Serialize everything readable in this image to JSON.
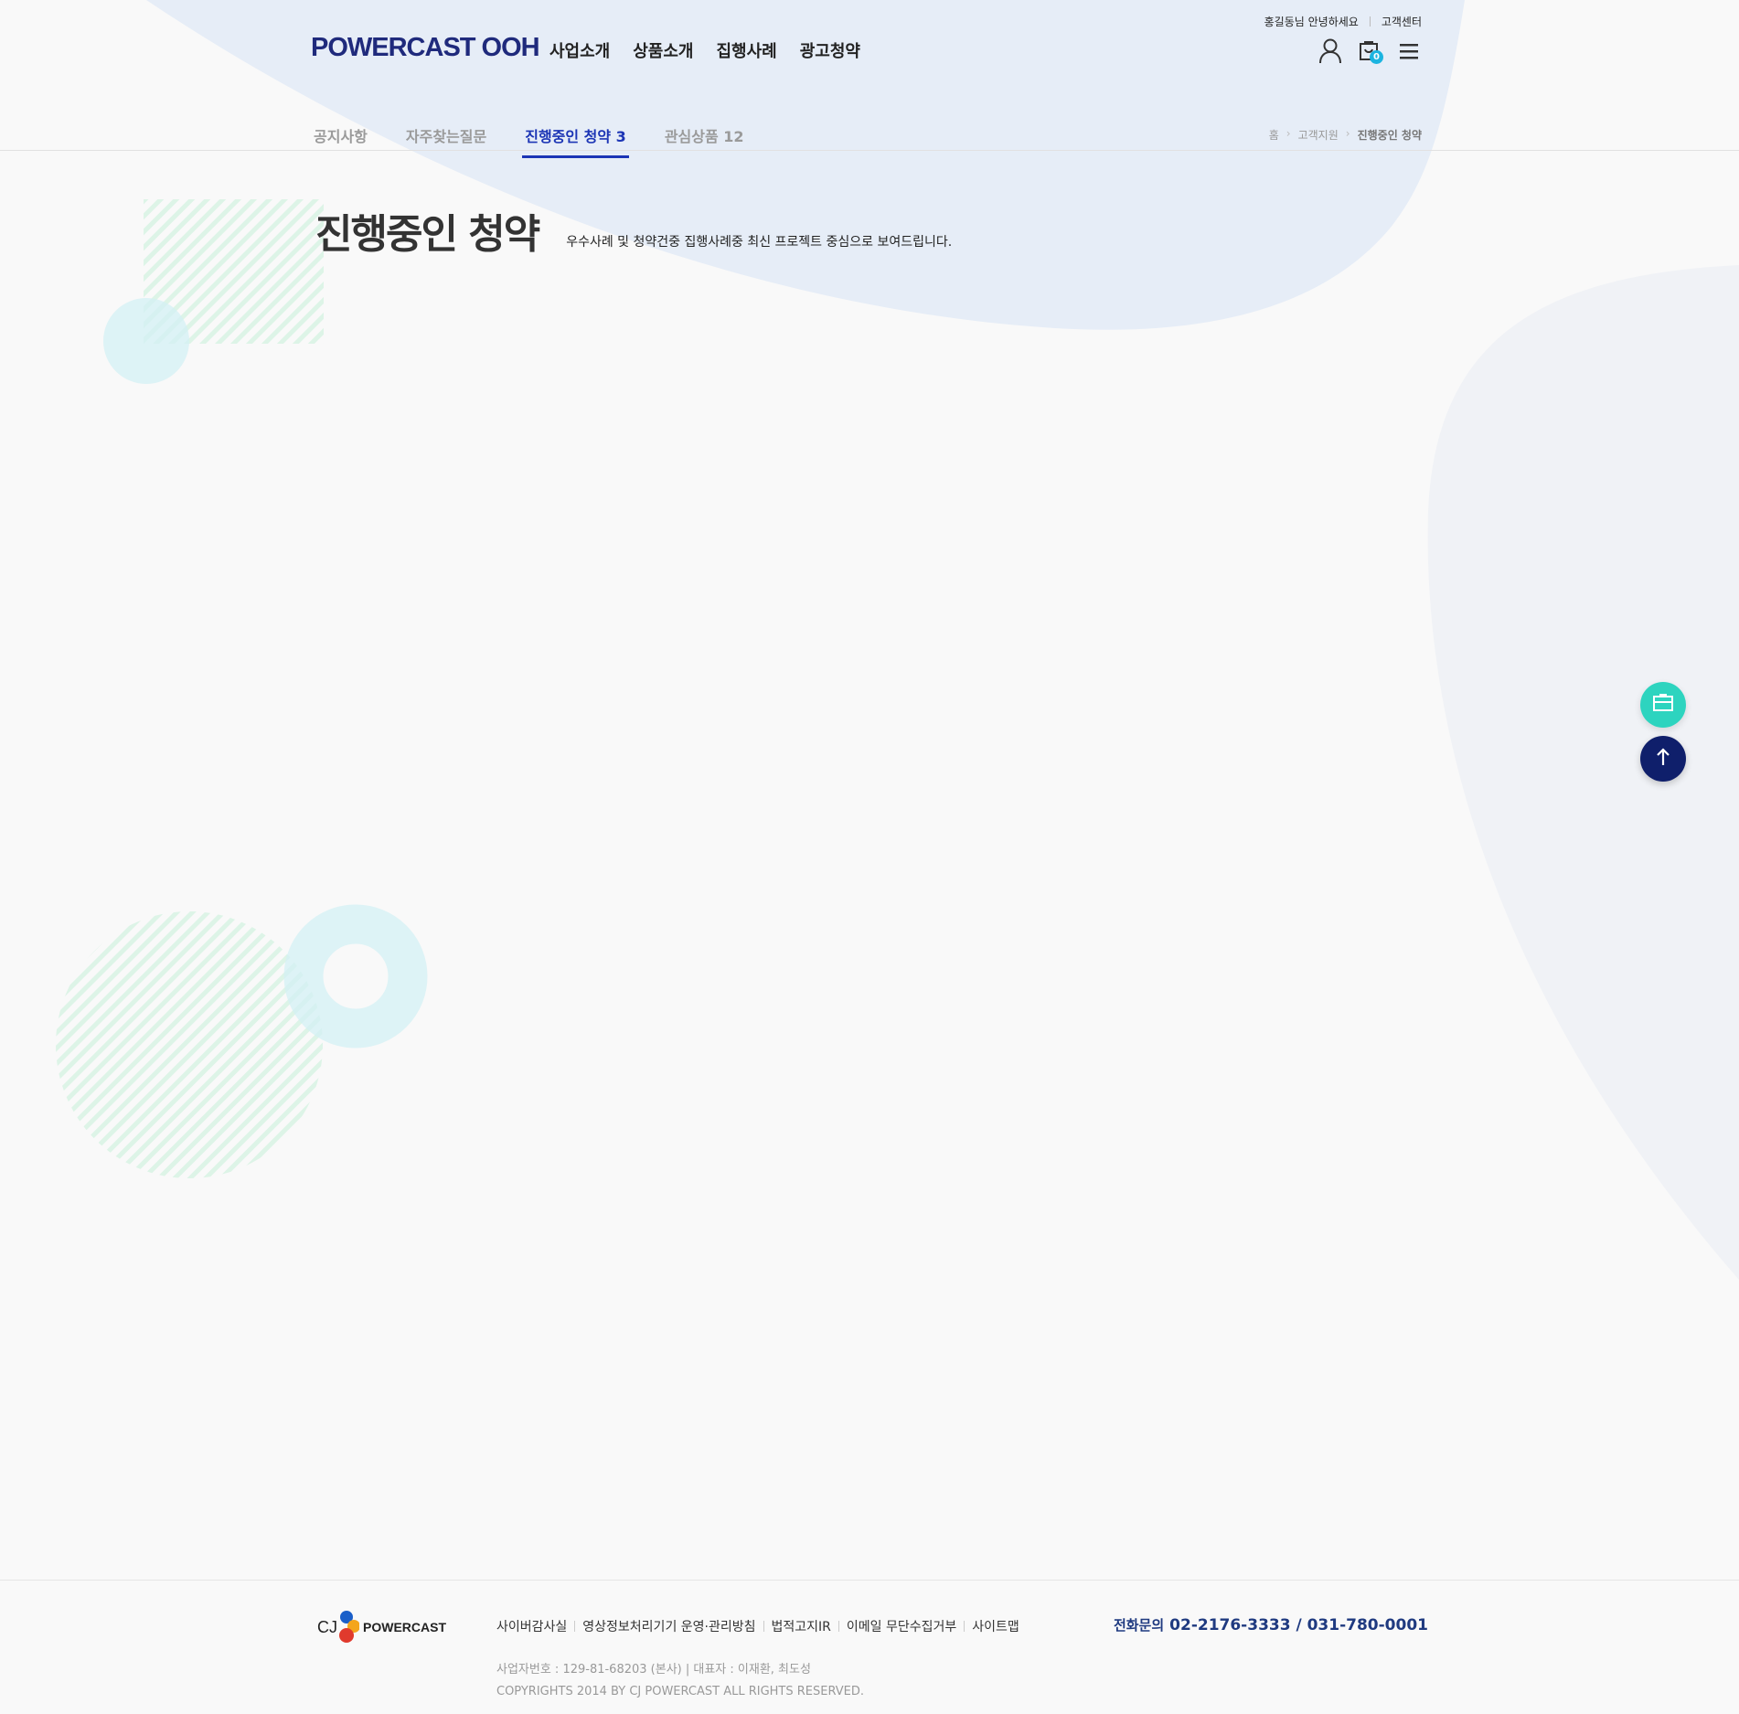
{
  "header": {
    "logo": "POWERCAST OOH",
    "user_greeting": "홍길동님 안녕하세요",
    "customer_center": "고객센터",
    "gnb": [
      "사업소개",
      "상품소개",
      "집행사례",
      "광고청약"
    ],
    "cart_count": "0"
  },
  "subnav": {
    "tabs": [
      "공지사항",
      "자주찾는질문",
      "진행중인 청약 3",
      "관심상품 12"
    ],
    "active_tab": 2,
    "breadcrumb": [
      "홈",
      "고객지원",
      "진행중인 청약"
    ]
  },
  "page": {
    "title": "진행중인 청약",
    "description": "우수사례 및 청약건중 집행사례중 최신 프로젝트 중심으로 보여드립니다."
  },
  "footer": {
    "brand_cj": "CJ",
    "brand_name": "POWERCAST",
    "links": [
      "사이버감사실",
      "영상정보처리기기 운영·관리방침",
      "법적고지IR",
      "이메일 무단수집거부",
      "사이트맵"
    ],
    "business_info": "사업자번호 : 129-81-68203 (본사) | 대표자 : 이재환, 최도성",
    "copyright": "COPYRIGHTS 2014 BY CJ POWERCAST ALL RIGHTS RESERVED.",
    "phone_label": "전화문의",
    "phone_numbers": "02-2176-3333 / 031-780-0001"
  },
  "colors": {
    "brand_navy": "#1f2a7c",
    "active_tab": "#1c35b5",
    "accent_teal": "#2dd4bf",
    "badge_cyan": "#1cb4e0",
    "top_button": "#0f1f6b",
    "blob_blue": "#e6edf7"
  },
  "icons": [
    "user-icon",
    "cart-icon",
    "menu-icon",
    "document-icon",
    "arrow-up-icon"
  ]
}
